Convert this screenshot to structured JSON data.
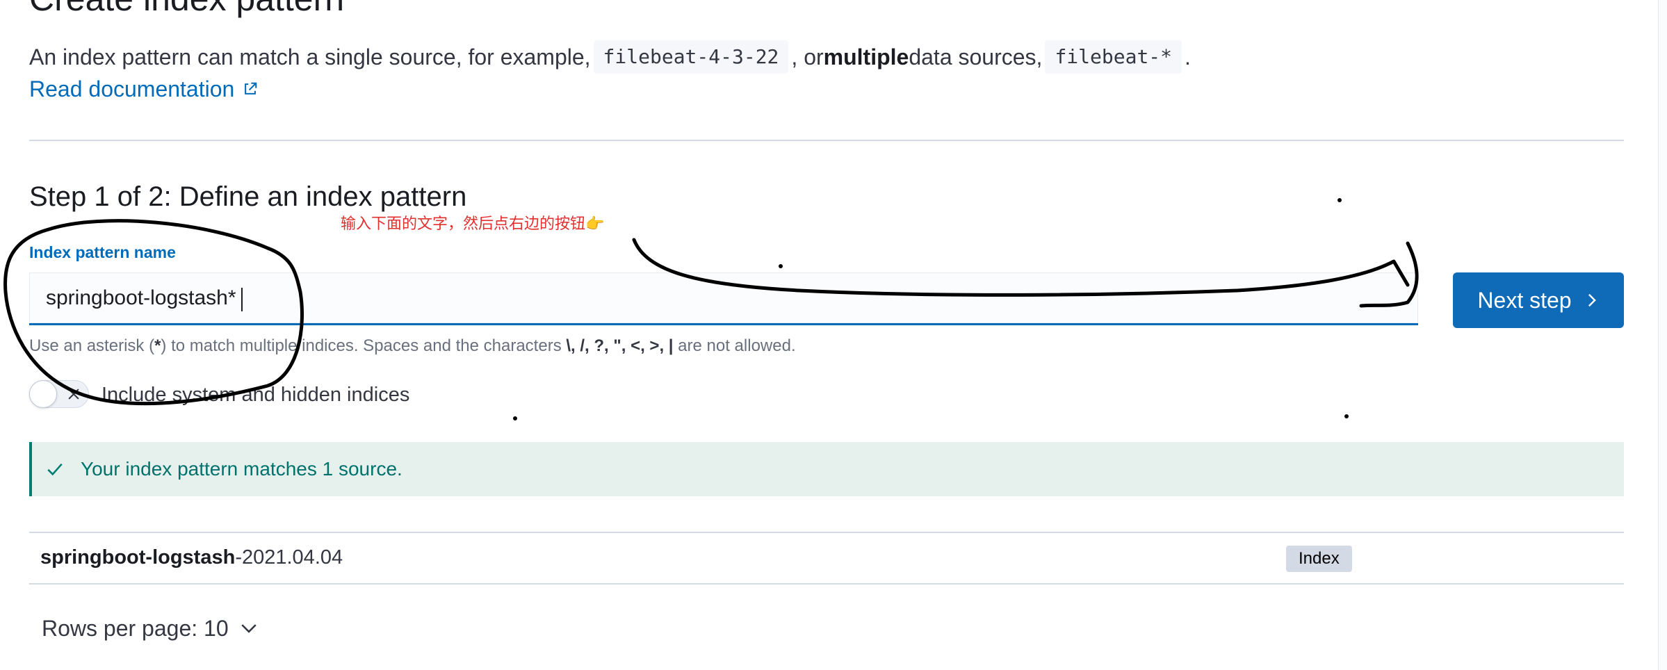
{
  "page": {
    "title": "Create index pattern",
    "intro": {
      "text_1": "An index pattern can match a single source, for example, ",
      "code_1": "filebeat-4-3-22",
      "text_2": ", or ",
      "bold": "multiple",
      "text_3": " data sources, ",
      "code_2": "filebeat-*",
      "text_4": "."
    },
    "doc_link": "Read documentation"
  },
  "step": {
    "title": "Step 1 of 2: Define an index pattern",
    "annotation": "输入下面的文字，然后点右边的按钮👉",
    "field_label": "Index pattern name",
    "field_value": "springboot-logstash*",
    "help": {
      "t1": "Use an asterisk (",
      "b1": "*",
      "t2": ") to match multiple indices. Spaces and the characters ",
      "b2": "\\, /, ?, \", <, >, |",
      "t3": " are not allowed."
    },
    "next_button": "Next step",
    "toggle_label": "Include system and hidden indices",
    "toggle_on": false
  },
  "callout": {
    "message": "Your index pattern matches 1 source.",
    "color": "#017d73"
  },
  "matches": {
    "rows": [
      {
        "name_bold": "springboot-logstash",
        "name_rest": "-2021.04.04",
        "badge": "Index"
      }
    ]
  },
  "pagination": {
    "rows_per_page": "Rows per page: 10"
  },
  "colors": {
    "primary": "#006bb8",
    "button": "#0f6bb8",
    "annotation": "#e0312f",
    "success_bg": "#e6f1ee"
  }
}
